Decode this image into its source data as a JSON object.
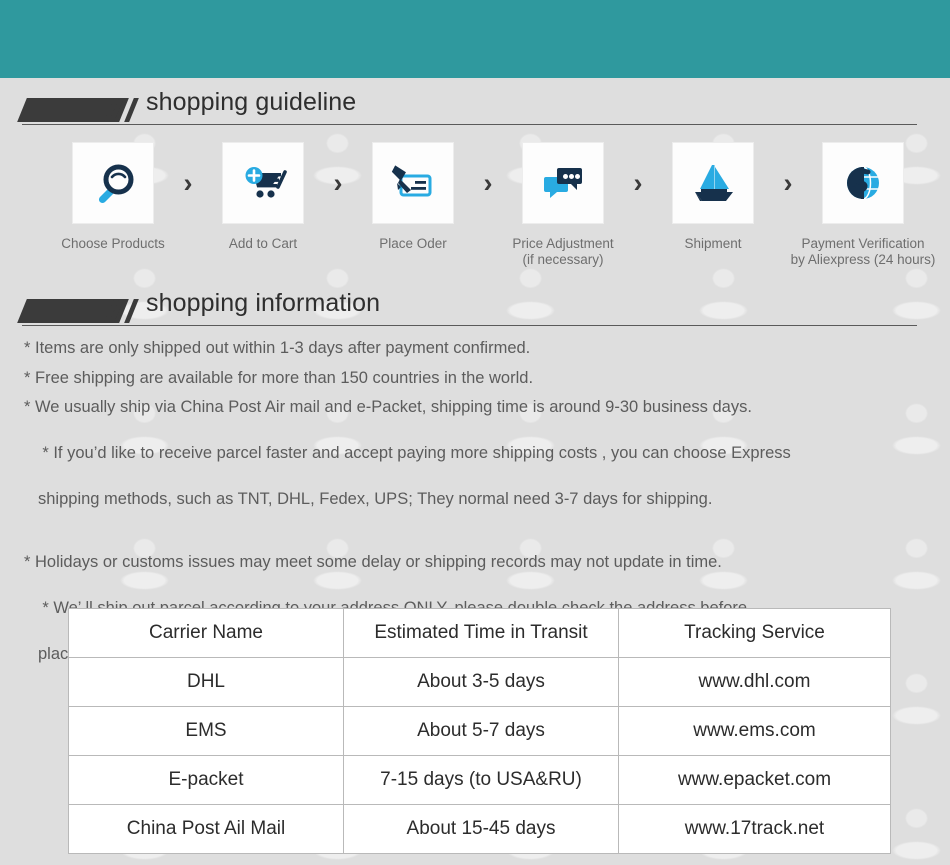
{
  "theme": {
    "banner_color": "#2f999e",
    "page_background": "#dedede",
    "icon_dark": "#1b3a58",
    "icon_blue": "#29abe2",
    "heading_color": "#2e2e2e",
    "body_text_color": "#5c5c5c",
    "table_border": "#b9b9b9"
  },
  "sections": {
    "guideline": {
      "title": "shopping guideline"
    },
    "information": {
      "title": "shopping information"
    }
  },
  "steps": [
    {
      "icon": "magnifier-icon",
      "label": "Choose Products",
      "label2": ""
    },
    {
      "icon": "add-to-cart-icon",
      "label": "Add to Cart",
      "label2": ""
    },
    {
      "icon": "pen-check-icon",
      "label": "Place Oder",
      "label2": ""
    },
    {
      "icon": "chat-bubbles-icon",
      "label": "Price Adjustment",
      "label2": "(if necessary)"
    },
    {
      "icon": "sailboat-icon",
      "label": "Shipment",
      "label2": ""
    },
    {
      "icon": "dollar-globe-icon",
      "label": "Payment Verification",
      "label2": "by  Aliexpress (24 hours)"
    }
  ],
  "step_separator": "›",
  "bullets": [
    {
      "text": "* Items are only shipped out within 1-3 days after payment confirmed.",
      "cont": ""
    },
    {
      "text": "* Free shipping are available for more than 150 countries in the world.",
      "cont": ""
    },
    {
      "text": "* We usually ship via China Post Air mail and e-Packet, shipping time is around 9-30 business days.",
      "cont": ""
    },
    {
      "text": "* If you’d like to receive parcel faster and accept paying more shipping costs , you can choose Express",
      "cont": "shipping methods, such as TNT, DHL, Fedex, UPS; They normal need 3-7 days for shipping."
    },
    {
      "text": "* Holidays or customs issues may meet some delay or shipping records may not update in time.",
      "cont": ""
    },
    {
      "text": "* We’ ll ship out parcel according to your address ONLY, please double check the address before",
      "cont": "placing order . Please check exactly Zip code and Post box number or House number."
    }
  ],
  "carrier_table": {
    "headers": [
      "Carrier Name",
      "Estimated Time in Transit",
      "Tracking Service"
    ],
    "rows": [
      [
        "DHL",
        "About 3-5 days",
        "www.dhl.com"
      ],
      [
        "EMS",
        "About 5-7 days",
        "www.ems.com"
      ],
      [
        "E-packet",
        "7-15 days (to USA&RU)",
        "www.epacket.com"
      ],
      [
        "China Post Ail Mail",
        "About 15-45 days",
        "www.17track.net"
      ]
    ]
  }
}
